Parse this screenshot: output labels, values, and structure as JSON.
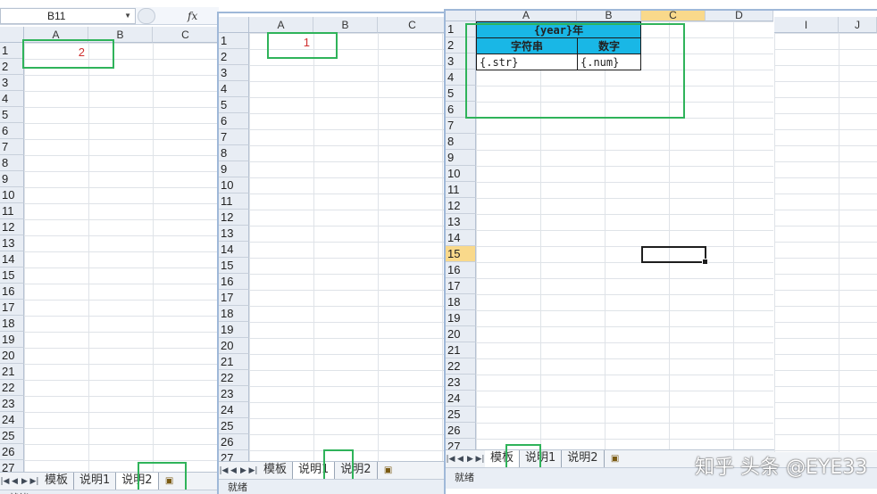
{
  "formula_bar": {
    "name_box": "B11",
    "fx_label": "fx"
  },
  "columns": {
    "back": [
      "A",
      "B",
      "C"
    ],
    "mid": [
      "A",
      "B",
      "C"
    ],
    "front": [
      "A",
      "B",
      "C",
      "D"
    ],
    "right_edge": [
      "I",
      "J"
    ]
  },
  "rows": [
    "1",
    "2",
    "3",
    "4",
    "5",
    "6",
    "7",
    "8",
    "9",
    "10",
    "11",
    "12",
    "13",
    "14",
    "15",
    "16",
    "17",
    "18",
    "19",
    "20",
    "21",
    "22",
    "23",
    "24",
    "25",
    "26",
    "27"
  ],
  "cell_values": {
    "back_A1": "2",
    "mid_A1": "1"
  },
  "template": {
    "title": "{year}年",
    "header_str": "字符串",
    "header_num": "数字",
    "data_str": "{.str}",
    "data_num": "{.num}"
  },
  "active_cell": {
    "row": "15",
    "column": "C"
  },
  "sheet_tabs": [
    "模板",
    "说明1",
    "说明2"
  ],
  "nav_icons": [
    "first-icon",
    "prev-icon",
    "next-icon",
    "last-icon"
  ],
  "status_text": "就绪",
  "status_text_back": "就绪",
  "watermark": "知乎 头条 @EYE33",
  "colors": {
    "template_fill": "#19b7e6",
    "highlight": "#2fb35a",
    "value_red": "#d03030",
    "selected_header": "#f9d98b"
  }
}
